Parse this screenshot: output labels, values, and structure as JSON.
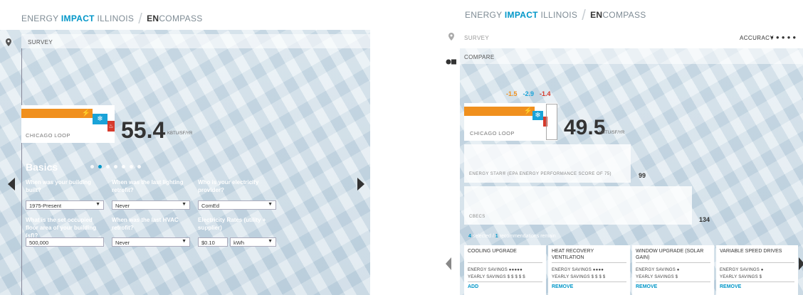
{
  "left": {
    "brand": {
      "a": "ENERGY ",
      "b": "IMPACT",
      "c": " ILLINOIS",
      "d": "EN",
      "e": "COMPASS"
    },
    "survey_label": "SURVEY",
    "building_label": "CHICAGO LOOP",
    "eui_value": "55.4",
    "eui_units": "KBTU/SF/YR",
    "basics_heading": "Basics",
    "questions": [
      {
        "label": "When was your building built?",
        "value": "1975-Present"
      },
      {
        "label": "When was the last lighting retrofit?",
        "value": "Never"
      },
      {
        "label": "Who is your electricity provider?",
        "value": "ComEd"
      },
      {
        "label": "What is the set occupied floor area of your building (sf)?",
        "value": "500,000"
      },
      {
        "label": "When was the last HVAC retrofit?",
        "value": "Never"
      },
      {
        "label": "Electricity Rates (utility + supplier)",
        "value": "$0.10",
        "unit": "kWh"
      }
    ],
    "pager_active": 1,
    "pager_count": 7
  },
  "right": {
    "brand": {
      "a": "ENERGY ",
      "b": "IMPACT",
      "c": " ILLINOIS",
      "d": "EN",
      "e": "COMPASS"
    },
    "survey_label": "SURVEY",
    "accuracy_label": "ACCURACY",
    "accuracy_dots": "● ● ● ● ●",
    "compare_label": "COMPARE",
    "deltas": [
      "-1.5",
      "-2.9",
      "-1.4"
    ],
    "delta_colors": [
      "#f0901e",
      "#1aa3d8",
      "#d63a2c"
    ],
    "building_label": "CHICAGO LOOP",
    "eui_value": "49.5",
    "eui_units": "KBTU/SF/YR",
    "energy_star_label": "ENERGY STAR® (EPA ENERGY PERFORMANCE SCORE OF 75)",
    "energy_star_value": "99",
    "cbecs_label": "CBECS",
    "cbecs_value": "134",
    "selected_count": "4",
    "selected_text": " selected / ",
    "remain_count": "1",
    "remain_text": " recommendations remain",
    "recommendations": [
      {
        "title": "COOLING UPGRADE",
        "energy": "ENERGY SAVINGS ●●●●●",
        "yearly": "YEARLY SAVINGS $ $ $ $ $",
        "action": "ADD"
      },
      {
        "title": "HEAT RECOVERY VENTILATION",
        "energy": "ENERGY SAVINGS ●●●●",
        "yearly": "YEARLY SAVINGS $ $ $ $",
        "action": "REMOVE"
      },
      {
        "title": "WINDOW UPGRADE (SOLAR GAIN)",
        "energy": "ENERGY SAVINGS ●",
        "yearly": "YEARLY SAVINGS $",
        "action": "REMOVE"
      },
      {
        "title": "VARIABLE SPEED DRIVES",
        "energy": "ENERGY SAVINGS ●",
        "yearly": "YEARLY SAVINGS $",
        "action": "REMOVE"
      }
    ]
  },
  "colors": {
    "orange": "#f0901e",
    "blue": "#1aa3d8",
    "red": "#d63a2c",
    "brand_blue": "#0096c8"
  }
}
